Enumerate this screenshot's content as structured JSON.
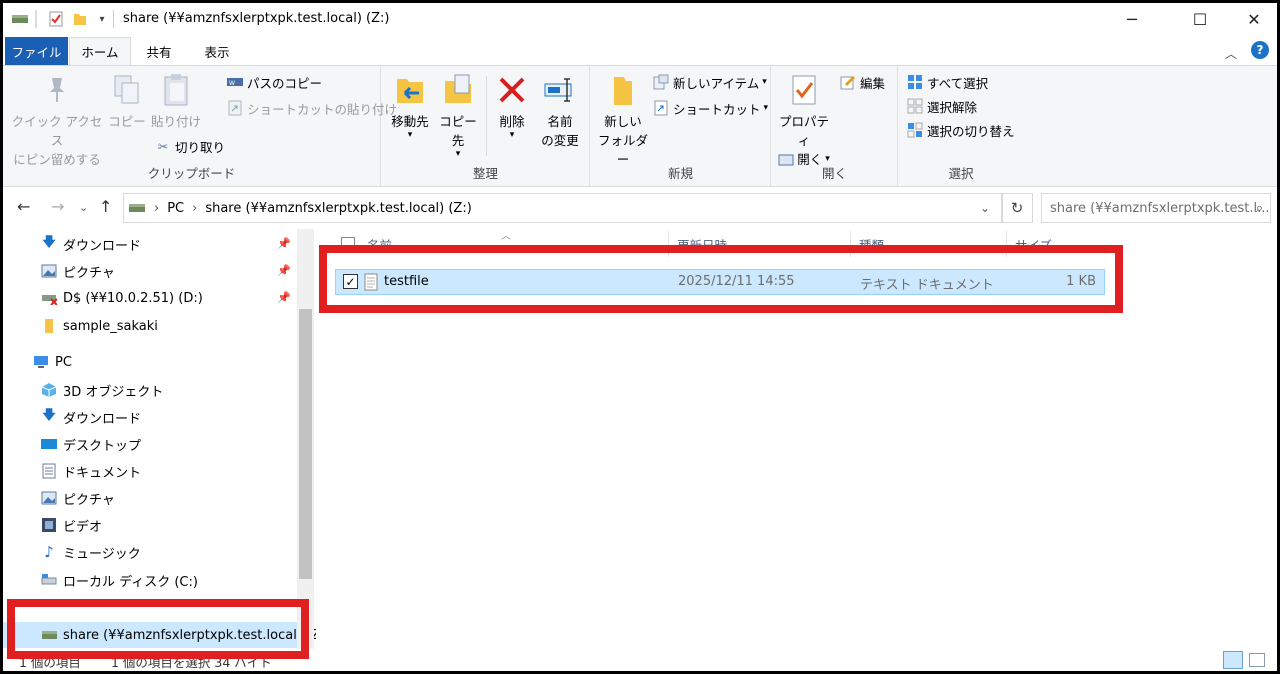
{
  "window": {
    "title": "share (¥¥amznfsxlerptxpk.test.local) (Z:)",
    "minimize_glyph": "─",
    "maximize_glyph": "☐",
    "close_glyph": "✕"
  },
  "tabs": [
    {
      "label": "ファイル"
    },
    {
      "label": "ホーム"
    },
    {
      "label": "共有"
    },
    {
      "label": "表示"
    }
  ],
  "ribbon": {
    "clipboard": {
      "pin_quick_access_line1": "クイック アクセス",
      "pin_quick_access_line2": "にピン留めする",
      "copy": "コピー",
      "paste": "貼り付け",
      "copy_path": "パスのコピー",
      "paste_shortcut": "ショートカットの貼り付け",
      "cut": "切り取り",
      "label": "クリップボード"
    },
    "organize": {
      "move_to": "移動先",
      "copy_to": "コピー先",
      "delete": "削除",
      "rename_line1": "名前",
      "rename_line2": "の変更",
      "label": "整理"
    },
    "new": {
      "new_folder_line1": "新しい",
      "new_folder_line2": "フォルダー",
      "new_item": "新しいアイテム",
      "shortcut": "ショートカット",
      "label": "新規"
    },
    "open": {
      "properties": "プロパティ",
      "open": "開く",
      "edit": "編集",
      "label": "開く"
    },
    "select": {
      "select_all": "すべて選択",
      "select_none": "選択解除",
      "invert": "選択の切り替え",
      "label": "選択"
    }
  },
  "address": {
    "pc": "PC",
    "location": "share (¥¥amznfsxlerptxpk.test.local) (Z:)",
    "search_placeholder": "share (¥¥amznfsxlerptxpk.test.l..."
  },
  "nav": {
    "quick_items": [
      {
        "label": "ダウンロード",
        "icon": "download-arrow-icon"
      },
      {
        "label": "ピクチャ",
        "icon": "pictures-icon"
      },
      {
        "label": "D$ (¥¥10.0.2.51) (D:)",
        "icon": "disconnected-drive-icon"
      },
      {
        "label": "sample_sakaki",
        "icon": "folder-icon"
      }
    ],
    "pc_label": "PC",
    "pc_items": [
      {
        "label": "3D オブジェクト",
        "icon": "3d-objects-icon"
      },
      {
        "label": "ダウンロード",
        "icon": "download-arrow-icon"
      },
      {
        "label": "デスクトップ",
        "icon": "desktop-icon"
      },
      {
        "label": "ドキュメント",
        "icon": "documents-icon"
      },
      {
        "label": "ピクチャ",
        "icon": "pictures-icon"
      },
      {
        "label": "ビデオ",
        "icon": "videos-icon"
      },
      {
        "label": "ミュージック",
        "icon": "music-icon"
      },
      {
        "label": "ローカル ディスク (C:)",
        "icon": "local-disk-icon"
      }
    ],
    "share_item": "share (¥¥amznfsxlerptxpk.test.local) (Z:)"
  },
  "files": {
    "columns": [
      "名前",
      "更新日時",
      "種類",
      "サイズ"
    ],
    "rows": [
      {
        "name": "testfile",
        "modified": "2025/12/11 14:55",
        "type": "テキスト ドキュメント",
        "size": "1 KB",
        "checked": true
      }
    ]
  },
  "status": {
    "count": "1 個の項目",
    "selected": "1 個の項目を選択  34 バイト"
  },
  "colors": {
    "highlight": "#e02020",
    "selection": "#cce8ff",
    "file_tab": "#1a5fb4"
  }
}
